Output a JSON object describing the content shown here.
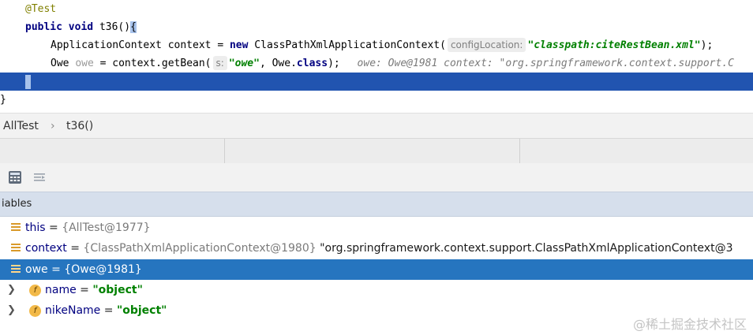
{
  "code": {
    "annotation": "@Test",
    "line2": {
      "kw1": "public",
      "kw2": "void",
      "method": "t36()",
      "brace": "{"
    },
    "line3": {
      "type": "ApplicationContext context = ",
      "kw_new": "new",
      "ctor": "ClassPathXmlApplicationContext(",
      "hint": "configLocation:",
      "str": "\"classpath:citeRestBean.xml\"",
      "end": ");"
    },
    "line4": {
      "owe": "Owe ",
      "owevar": "owe",
      "mid": " = context.getBean(",
      "hint": "s:",
      "str": "\"owe\"",
      "comma": ", Owe.",
      "kw_class": "class",
      "end": ");",
      "inline": "owe: Owe@1981   context: \"org.springframework.context.support.C"
    },
    "line5": "}",
    "line6": "}"
  },
  "breadcrumb": {
    "class_name": "AllTest",
    "sep": "›",
    "method": "t36()"
  },
  "variables": {
    "header": "iables",
    "rows": [
      {
        "name": "this",
        "eq": " = ",
        "value": "{AllTest@1977}",
        "extra": ""
      },
      {
        "name": "context",
        "eq": " = ",
        "value": "{ClassPathXmlApplicationContext@1980}",
        "extra": " \"org.springframework.context.support.ClassPathXmlApplicationContext@3"
      },
      {
        "name": "owe",
        "eq": " = ",
        "value": "{Owe@1981}",
        "extra": ""
      }
    ],
    "fields": [
      {
        "name": "name",
        "eq": " = ",
        "value": "\"object\""
      },
      {
        "name": "nikeName",
        "eq": " = ",
        "value": "\"object\""
      }
    ]
  },
  "icons": {
    "calculator": "calculator-icon",
    "stepping": "restore-layout-icon",
    "field": "field-icon",
    "expand": "chevron-right-icon",
    "variable": "variable-icon"
  },
  "watermark": "@稀土掘金技术社区",
  "colors": {
    "exec_line": "#2154b0",
    "selected_row": "#2675bf",
    "var_header": "#d6dfec"
  }
}
